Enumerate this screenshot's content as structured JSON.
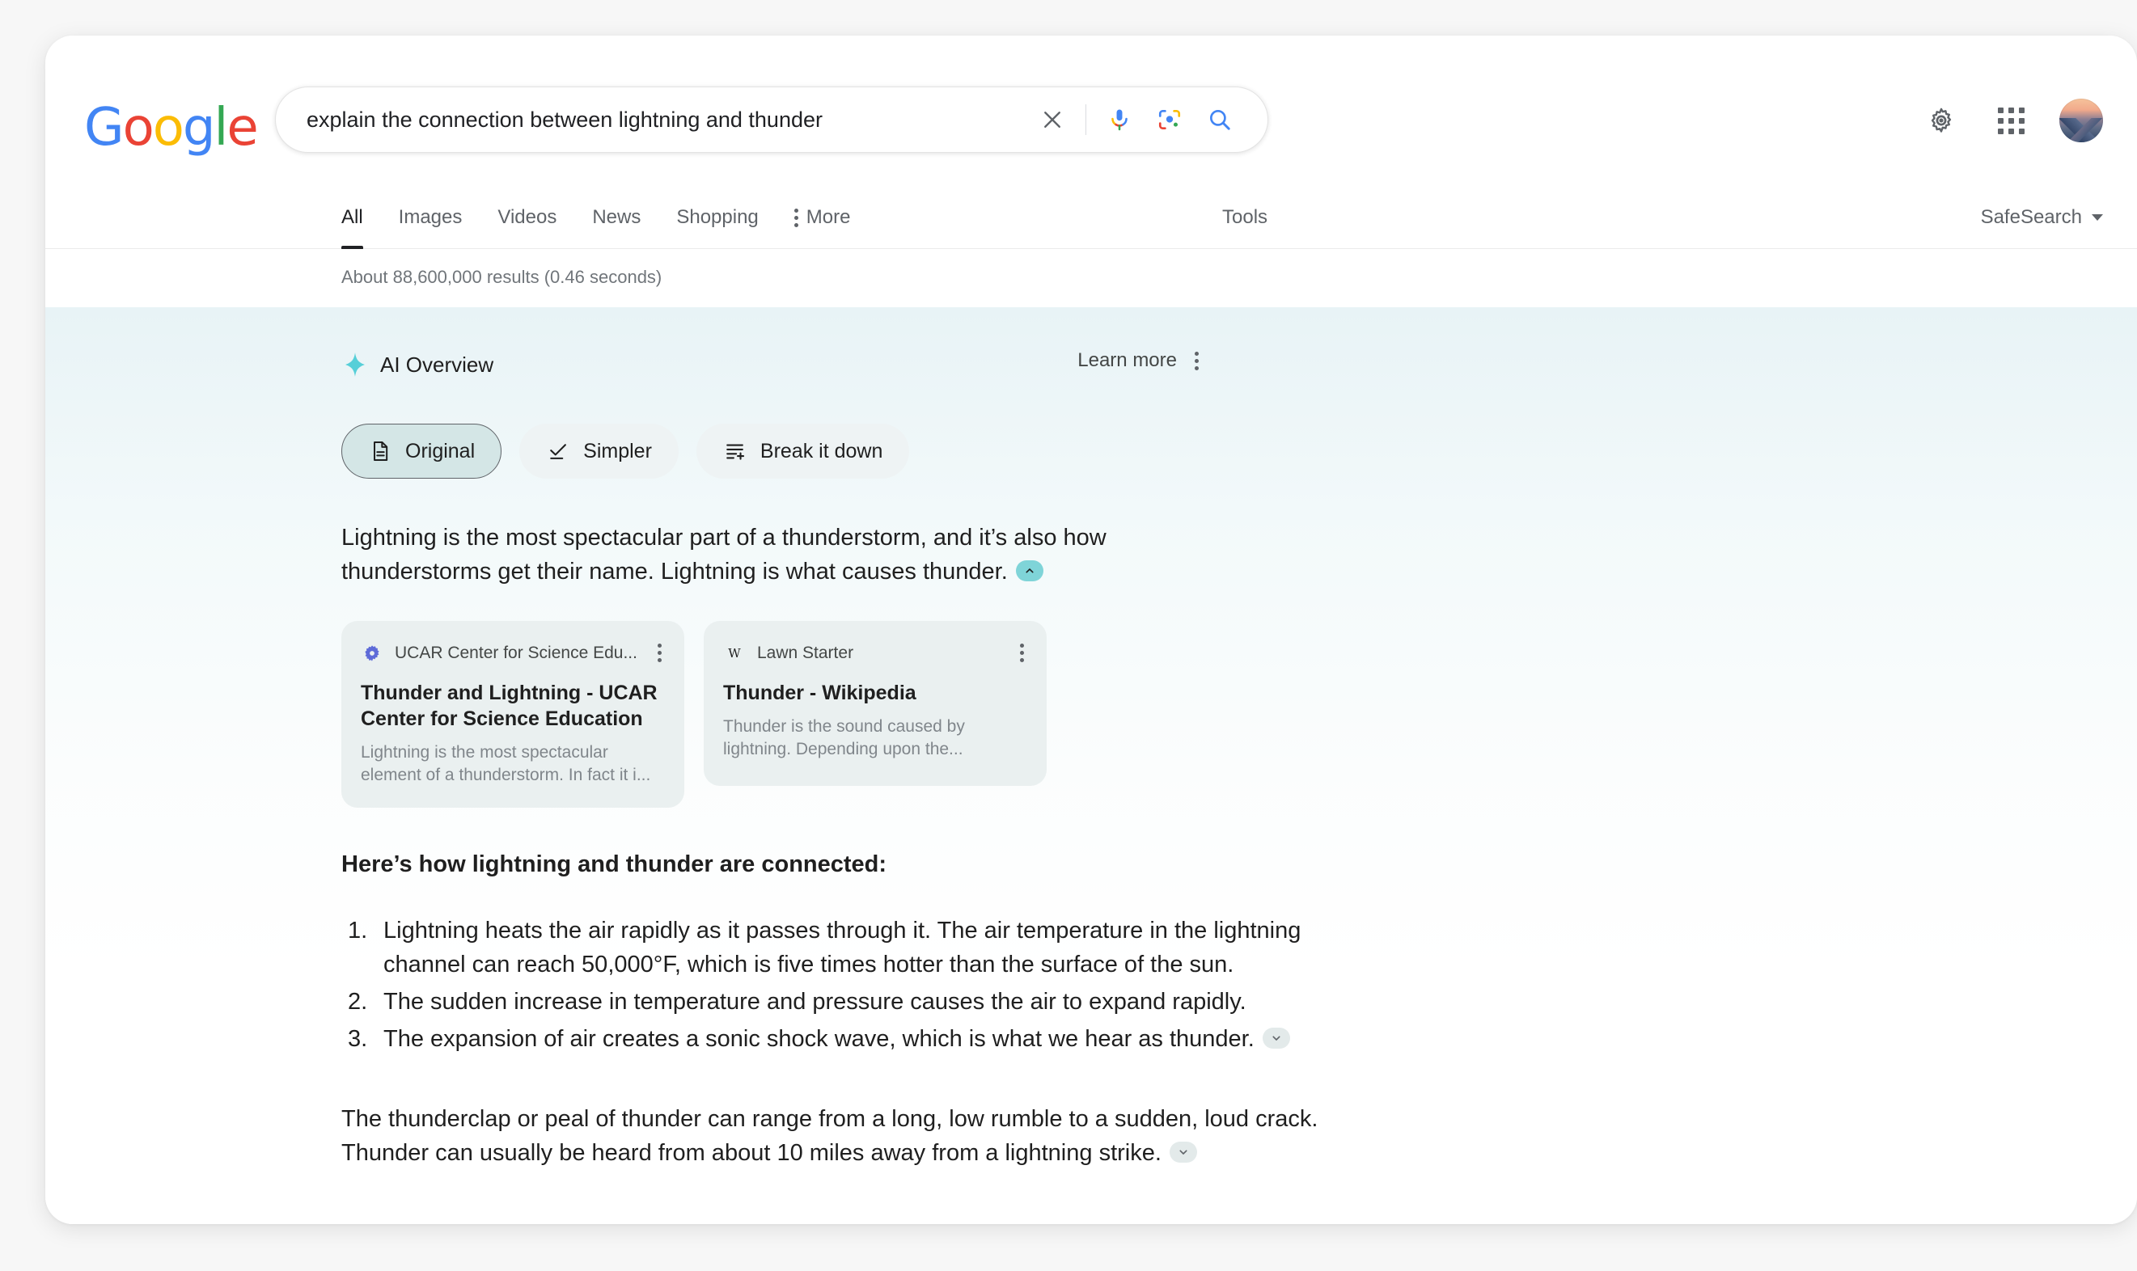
{
  "header": {
    "logo_letters": [
      {
        "ch": "G",
        "color": "#4285F4"
      },
      {
        "ch": "o",
        "color": "#EA4335"
      },
      {
        "ch": "o",
        "color": "#FBBC05"
      },
      {
        "ch": "g",
        "color": "#4285F4"
      },
      {
        "ch": "l",
        "color": "#34A853"
      },
      {
        "ch": "e",
        "color": "#EA4335"
      }
    ],
    "logo_alt": "Google",
    "search": {
      "value": "explain the connection between lightning and thunder",
      "placeholder": "Search",
      "clear_icon": "close-icon",
      "voice_icon": "microphone-icon",
      "lens_icon": "google-lens-icon",
      "search_icon": "search-icon"
    },
    "settings_icon": "gear-icon",
    "apps_icon": "apps-grid-icon",
    "avatar_icon": "account-avatar"
  },
  "nav": {
    "tabs": [
      {
        "label": "All",
        "active": true
      },
      {
        "label": "Images",
        "active": false
      },
      {
        "label": "Videos",
        "active": false
      },
      {
        "label": "News",
        "active": false
      },
      {
        "label": "Shopping",
        "active": false
      }
    ],
    "more_label": "More",
    "more_icon": "more-vertical-icon",
    "tools_label": "Tools",
    "safesearch_label": "SafeSearch",
    "safesearch_caret_icon": "chevron-down-icon"
  },
  "results": {
    "stats": "About 88,600,000 results (0.46 seconds)"
  },
  "ai_overview": {
    "sparkle_icon": "ai-sparkle-icon",
    "title": "AI Overview",
    "learn_more_label": "Learn more",
    "overflow_icon": "more-vertical-icon",
    "chips": [
      {
        "label": "Original",
        "icon": "document-icon",
        "selected": true
      },
      {
        "label": "Simpler",
        "icon": "simplify-check-icon",
        "selected": false
      },
      {
        "label": "Break it down",
        "icon": "list-plus-icon",
        "selected": false
      }
    ],
    "paragraph_1": "Lightning is the most spectacular part of a thunderstorm, and it’s also how thunderstorms get their name. Lightning is what causes thunder.",
    "paragraph_1_citation_icon": "chevron-up-icon",
    "sources": [
      {
        "site": "UCAR Center for Science Edu...",
        "favicon": "ucar-gear-favicon",
        "title": "Thunder and Lightning - UCAR Center for Science Education",
        "snippet": "Lightning is the most spectacular element of a thunderstorm. In fact it i...",
        "menu_icon": "more-vertical-icon"
      },
      {
        "site": "Lawn Starter",
        "favicon": "wikipedia-w-favicon",
        "title": "Thunder - Wikipedia",
        "snippet": "Thunder is the sound caused by lightning. Depending upon the...",
        "menu_icon": "more-vertical-icon"
      }
    ],
    "heading": "Here’s how lightning and thunder are connected:",
    "list": [
      {
        "num": "1.",
        "text": "Lightning heats the air rapidly as it passes through it. The air temperature in the lightning channel can reach 50,000°F, which is five times hotter than the surface of the sun."
      },
      {
        "num": "2.",
        "text": "The sudden increase in temperature and pressure causes the air to expand rapidly."
      },
      {
        "num": "3.",
        "text": "The expansion of air creates a sonic shock wave, which is what we hear as thunder.",
        "citation_icon": "chevron-down-icon"
      }
    ],
    "paragraph_2": "The thunderclap or peal of thunder can range from a long, low rumble to a sudden, loud crack. Thunder can usually be heard from about 10 miles away from a lightning strike.",
    "paragraph_2_citation_icon": "chevron-down-icon"
  },
  "colors": {
    "accent_teal": "#7fd4d8",
    "chip_selected_bg": "#d4e6e6",
    "chip_bg": "#eef3f4",
    "source_card_bg": "#eaf0f0",
    "text_primary": "#1f1f1f",
    "text_secondary": "#5f6368"
  }
}
